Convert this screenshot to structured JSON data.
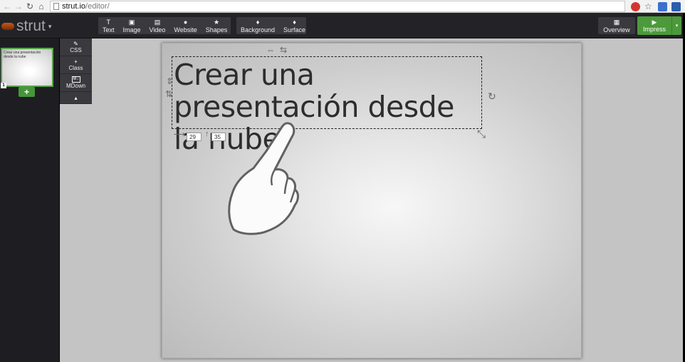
{
  "browser": {
    "back_icon": "arrow-left",
    "forward_icon": "arrow-right",
    "reload_icon": "reload",
    "home_icon": "home",
    "url_host": "strut.io",
    "url_path": "/editor/",
    "extensions": [
      "#d2352f",
      "#f2f2f2",
      "#3b6fd0",
      "#2a5db0"
    ]
  },
  "app": {
    "logo_text": "strut",
    "toolbar_insert": [
      {
        "icon": "T",
        "label": "Text"
      },
      {
        "icon": "▣",
        "label": "Image"
      },
      {
        "icon": "▤",
        "label": "Video"
      },
      {
        "icon": "●",
        "label": "Website"
      },
      {
        "icon": "★",
        "label": "Shapes"
      }
    ],
    "toolbar_style": [
      {
        "icon": "💧",
        "label": "Background"
      },
      {
        "icon": "💧",
        "label": "Surface"
      }
    ],
    "overview": {
      "icon": "▦",
      "label": "Overview"
    },
    "impress": {
      "icon": "▶",
      "label": "Impress"
    }
  },
  "well": {
    "slide_number": "1",
    "thumb_text": "Crear una presentación desde la nube",
    "add_label": "+"
  },
  "side_tools": [
    {
      "icon": "✎",
      "label": "CSS"
    },
    {
      "icon": "+",
      "label": "Class"
    },
    {
      "icon": "M↓",
      "label": "MDown"
    },
    {
      "icon": "▴",
      "label": ""
    }
  ],
  "slide": {
    "title": "Crear una presentación desde la nube",
    "x_value": "29",
    "y_value": "35"
  },
  "colors": {
    "accent_green": "#4c9a3b",
    "toolbar_bg": "#232327"
  }
}
